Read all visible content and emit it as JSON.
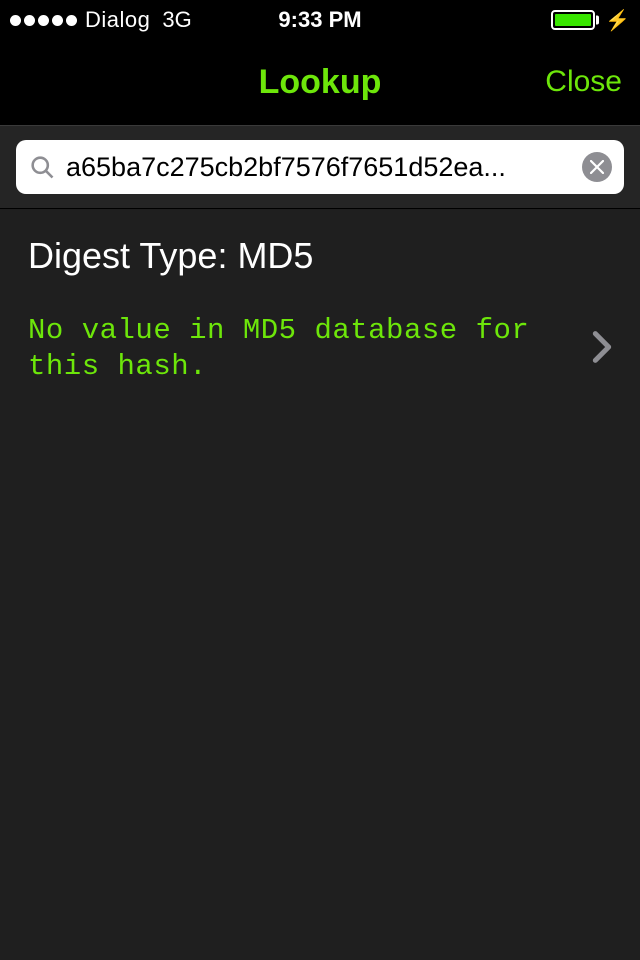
{
  "status_bar": {
    "carrier": "Dialog",
    "network": "3G",
    "time": "9:33 PM"
  },
  "nav": {
    "title": "Lookup",
    "close_label": "Close"
  },
  "search": {
    "value": "a65ba7c275cb2bf7576f7651d52ea..."
  },
  "content": {
    "digest_heading": "Digest Type: MD5",
    "result_message": "No value in MD5 database for this hash."
  }
}
